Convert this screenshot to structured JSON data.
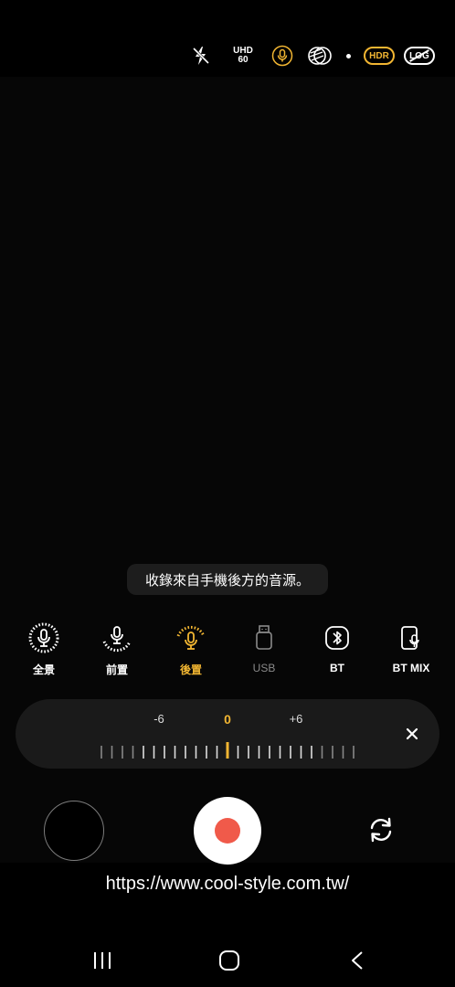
{
  "status_bar": {
    "flash_icon": "flash-off-icon",
    "resolution_top": "UHD",
    "resolution_bottom": "60",
    "mic_icon": "microphone-icon",
    "stabilization_icon": "stabilization-icon",
    "hdr_label": "HDR",
    "log_label": "LOG"
  },
  "toast": {
    "message": "收錄來自手機後方的音源。"
  },
  "mic_modes": [
    {
      "label": "全景",
      "icon": "omni-mic-icon",
      "state": "normal"
    },
    {
      "label": "前置",
      "icon": "front-mic-icon",
      "state": "normal"
    },
    {
      "label": "後置",
      "icon": "rear-mic-icon",
      "state": "active"
    },
    {
      "label": "USB",
      "icon": "usb-icon",
      "state": "disabled"
    },
    {
      "label": "BT",
      "icon": "bluetooth-icon",
      "state": "normal"
    },
    {
      "label": "BT MIX",
      "icon": "bt-mix-icon",
      "state": "normal"
    }
  ],
  "gain": {
    "min_label": "-6",
    "value_label": "0",
    "max_label": "+6",
    "value": 0,
    "range": [
      -6,
      6
    ],
    "close_icon": "close-icon"
  },
  "controls": {
    "record_icon": "record-icon",
    "switch_icon": "switch-camera-icon"
  },
  "watermark": "https://www.cool-style.com.tw/",
  "nav": {
    "recents_icon": "recents-icon",
    "home_icon": "home-icon",
    "back_icon": "back-icon"
  },
  "colors": {
    "accent": "#f2b632",
    "record": "#f05a4a",
    "panel": "#1a1a1a"
  }
}
